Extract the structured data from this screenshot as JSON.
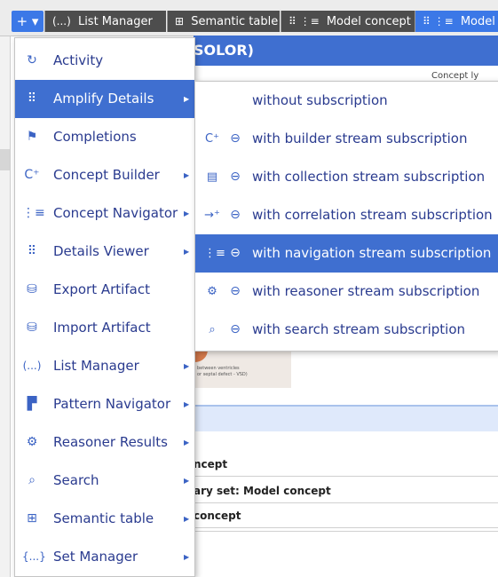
{
  "tabbar": {
    "add_label": "+ ▾",
    "tabs": [
      {
        "icon_name": "list-manager-icon",
        "icon": "(...)",
        "label": "List Manager"
      },
      {
        "icon_name": "table-icon",
        "icon": "⊞",
        "label": "Semantic table"
      },
      {
        "icon_name": "model-concept-icon",
        "icon": "⠿ ⋮≡",
        "label": "Model concept"
      },
      {
        "icon_name": "model-concept-icon",
        "icon": "⠿ ⋮≡",
        "label": "Model"
      }
    ]
  },
  "background": {
    "header_text": "SOLOR)",
    "sub_text": "Concept ly",
    "image_caption": "between ventricles\nor septal defect - VSD)",
    "rows": [
      "ncept",
      "ary set: Model concept",
      "concept"
    ]
  },
  "menu": {
    "items": [
      {
        "icon_name": "activity-icon",
        "icon": "↻",
        "label": "Activity",
        "has_sub": false
      },
      {
        "icon_name": "amplify-details-icon",
        "icon": "⠿",
        "label": "Amplify Details",
        "has_sub": true
      },
      {
        "icon_name": "completions-icon",
        "icon": "⚑",
        "label": "Completions",
        "has_sub": false
      },
      {
        "icon_name": "concept-builder-icon",
        "icon": "C⁺",
        "label": "Concept Builder",
        "has_sub": true
      },
      {
        "icon_name": "concept-navigator-icon",
        "icon": "⋮≡",
        "label": "Concept Navigator",
        "has_sub": true
      },
      {
        "icon_name": "details-viewer-icon",
        "icon": "⠿",
        "label": "Details Viewer",
        "has_sub": true
      },
      {
        "icon_name": "export-artifact-icon",
        "icon": "⛁",
        "label": "Export Artifact",
        "has_sub": false
      },
      {
        "icon_name": "import-artifact-icon",
        "icon": "⛁",
        "label": "Import Artifact",
        "has_sub": false
      },
      {
        "icon_name": "list-manager-icon",
        "icon": "(...)",
        "label": "List Manager",
        "has_sub": true
      },
      {
        "icon_name": "pattern-navigator-icon",
        "icon": "▛",
        "label": "Pattern Navigator",
        "has_sub": true
      },
      {
        "icon_name": "reasoner-results-icon",
        "icon": "⚙",
        "label": "Reasoner Results",
        "has_sub": true
      },
      {
        "icon_name": "search-icon",
        "icon": "⌕",
        "label": "Search",
        "has_sub": true
      },
      {
        "icon_name": "semantic-table-icon",
        "icon": "⊞",
        "label": "Semantic table",
        "has_sub": true
      },
      {
        "icon_name": "set-manager-icon",
        "icon": "{...}",
        "label": "Set Manager",
        "has_sub": true
      }
    ],
    "highlighted_index": 1,
    "arrow_glyph": "▶"
  },
  "submenu": {
    "items": [
      {
        "icon1_name": "",
        "icon1": "",
        "icon2_name": "",
        "icon2": "",
        "label": "without subscription"
      },
      {
        "icon1_name": "concept-builder-icon",
        "icon1": "C⁺",
        "icon2_name": "subscribe-icon",
        "icon2": "⊖",
        "label": "with builder stream subscription"
      },
      {
        "icon1_name": "collection-icon",
        "icon1": "▤",
        "icon2_name": "subscribe-icon",
        "icon2": "⊖",
        "label": "with collection stream subscription"
      },
      {
        "icon1_name": "correlation-icon",
        "icon1": "→⁺",
        "icon2_name": "subscribe-icon",
        "icon2": "⊖",
        "label": "with correlation stream subscription"
      },
      {
        "icon1_name": "concept-navigator-icon",
        "icon1": "⋮≡",
        "icon2_name": "subscribe-icon",
        "icon2": "⊖",
        "label": "with navigation stream subscription"
      },
      {
        "icon1_name": "reasoner-icon",
        "icon1": "⚙",
        "icon2_name": "subscribe-icon",
        "icon2": "⊖",
        "label": "with reasoner stream subscription"
      },
      {
        "icon1_name": "search-icon",
        "icon1": "⌕",
        "icon2_name": "subscribe-icon",
        "icon2": "⊖",
        "label": "with search stream subscription"
      }
    ],
    "highlighted_index": 4
  }
}
